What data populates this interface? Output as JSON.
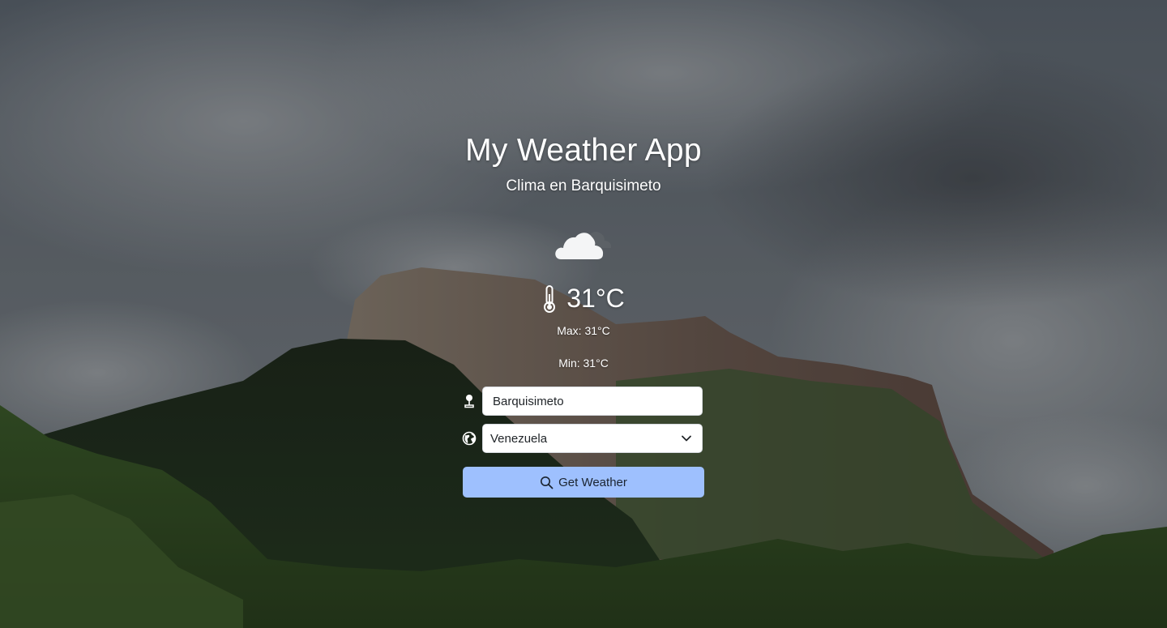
{
  "app": {
    "title": "My Weather App",
    "subtitle": "Clima en Barquisimeto"
  },
  "weather": {
    "condition_icon": "cloudy-icon",
    "temperature": "31°C",
    "max": "Max: 31°C",
    "min": "Min: 31°C"
  },
  "form": {
    "city_value": "Barquisimeto",
    "city_icon": "location-pin-icon",
    "country_selected": "Venezuela",
    "country_icon": "globe-icon",
    "button_label": "Get Weather",
    "button_icon": "search-icon"
  },
  "colors": {
    "button_bg": "#9ec0fe",
    "text": "#ffffff"
  }
}
